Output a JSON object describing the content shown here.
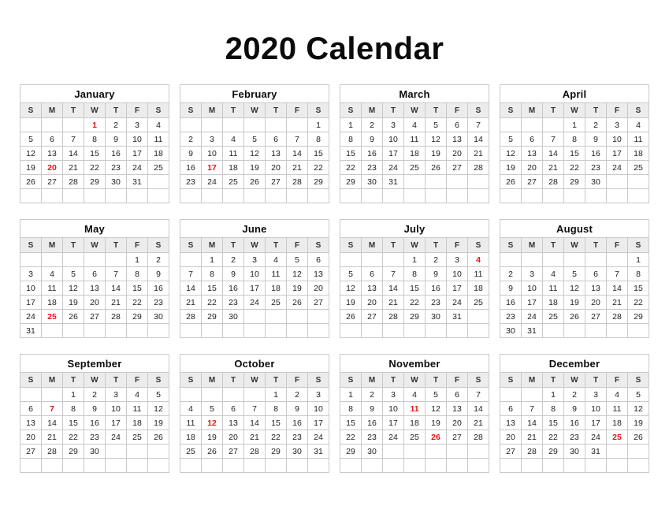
{
  "page": {
    "title": "2020 Calendar",
    "year": "2020",
    "background_color": "#ffffff",
    "title_color": "#0b0b0b",
    "holiday_color": "#ee1111",
    "grid_line_color": "#c9c9c9",
    "weekday_header_background": "#ececec",
    "weekday_header_color": "#333333",
    "day_text_color": "#222222"
  },
  "weekday_labels": [
    "S",
    "M",
    "T",
    "W",
    "T",
    "F",
    "S"
  ],
  "months": [
    {
      "name": "January",
      "weeks": [
        [
          "",
          "",
          "",
          "1",
          "2",
          "3",
          "4"
        ],
        [
          "5",
          "6",
          "7",
          "8",
          "9",
          "10",
          "11"
        ],
        [
          "12",
          "13",
          "14",
          "15",
          "16",
          "17",
          "18"
        ],
        [
          "19",
          "20",
          "21",
          "22",
          "23",
          "24",
          "25"
        ],
        [
          "26",
          "27",
          "28",
          "29",
          "30",
          "31",
          ""
        ],
        [
          "",
          "",
          "",
          "",
          "",
          "",
          ""
        ]
      ],
      "holidays": [
        "1",
        "20"
      ]
    },
    {
      "name": "February",
      "weeks": [
        [
          "",
          "",
          "",
          "",
          "",
          "",
          "1"
        ],
        [
          "2",
          "3",
          "4",
          "5",
          "6",
          "7",
          "8"
        ],
        [
          "9",
          "10",
          "11",
          "12",
          "13",
          "14",
          "15"
        ],
        [
          "16",
          "17",
          "18",
          "19",
          "20",
          "21",
          "22"
        ],
        [
          "23",
          "24",
          "25",
          "26",
          "27",
          "28",
          "29"
        ],
        [
          "",
          "",
          "",
          "",
          "",
          "",
          ""
        ]
      ],
      "holidays": [
        "17"
      ]
    },
    {
      "name": "March",
      "weeks": [
        [
          "1",
          "2",
          "3",
          "4",
          "5",
          "6",
          "7"
        ],
        [
          "8",
          "9",
          "10",
          "11",
          "12",
          "13",
          "14"
        ],
        [
          "15",
          "16",
          "17",
          "18",
          "19",
          "20",
          "21"
        ],
        [
          "22",
          "23",
          "24",
          "25",
          "26",
          "27",
          "28"
        ],
        [
          "29",
          "30",
          "31",
          "",
          "",
          "",
          ""
        ],
        [
          "",
          "",
          "",
          "",
          "",
          "",
          ""
        ]
      ],
      "holidays": []
    },
    {
      "name": "April",
      "weeks": [
        [
          "",
          "",
          "",
          "1",
          "2",
          "3",
          "4"
        ],
        [
          "5",
          "6",
          "7",
          "8",
          "9",
          "10",
          "11"
        ],
        [
          "12",
          "13",
          "14",
          "15",
          "16",
          "17",
          "18"
        ],
        [
          "19",
          "20",
          "21",
          "22",
          "23",
          "24",
          "25"
        ],
        [
          "26",
          "27",
          "28",
          "29",
          "30",
          "",
          ""
        ],
        [
          "",
          "",
          "",
          "",
          "",
          "",
          ""
        ]
      ],
      "holidays": []
    },
    {
      "name": "May",
      "weeks": [
        [
          "",
          "",
          "",
          "",
          "",
          "1",
          "2"
        ],
        [
          "3",
          "4",
          "5",
          "6",
          "7",
          "8",
          "9"
        ],
        [
          "10",
          "11",
          "12",
          "13",
          "14",
          "15",
          "16"
        ],
        [
          "17",
          "18",
          "19",
          "20",
          "21",
          "22",
          "23"
        ],
        [
          "24",
          "25",
          "26",
          "27",
          "28",
          "29",
          "30"
        ],
        [
          "31",
          "",
          "",
          "",
          "",
          "",
          ""
        ]
      ],
      "holidays": [
        "25"
      ]
    },
    {
      "name": "June",
      "weeks": [
        [
          "",
          "1",
          "2",
          "3",
          "4",
          "5",
          "6"
        ],
        [
          "7",
          "8",
          "9",
          "10",
          "11",
          "12",
          "13"
        ],
        [
          "14",
          "15",
          "16",
          "17",
          "18",
          "19",
          "20"
        ],
        [
          "21",
          "22",
          "23",
          "24",
          "25",
          "26",
          "27"
        ],
        [
          "28",
          "29",
          "30",
          "",
          "",
          "",
          ""
        ],
        [
          "",
          "",
          "",
          "",
          "",
          "",
          ""
        ]
      ],
      "holidays": []
    },
    {
      "name": "July",
      "weeks": [
        [
          "",
          "",
          "",
          "1",
          "2",
          "3",
          "4"
        ],
        [
          "5",
          "6",
          "7",
          "8",
          "9",
          "10",
          "11"
        ],
        [
          "12",
          "13",
          "14",
          "15",
          "16",
          "17",
          "18"
        ],
        [
          "19",
          "20",
          "21",
          "22",
          "23",
          "24",
          "25"
        ],
        [
          "26",
          "27",
          "28",
          "29",
          "30",
          "31",
          ""
        ],
        [
          "",
          "",
          "",
          "",
          "",
          "",
          ""
        ]
      ],
      "holidays": [
        "4"
      ]
    },
    {
      "name": "August",
      "weeks": [
        [
          "",
          "",
          "",
          "",
          "",
          "",
          "1"
        ],
        [
          "2",
          "3",
          "4",
          "5",
          "6",
          "7",
          "8"
        ],
        [
          "9",
          "10",
          "11",
          "12",
          "13",
          "14",
          "15"
        ],
        [
          "16",
          "17",
          "18",
          "19",
          "20",
          "21",
          "22"
        ],
        [
          "23",
          "24",
          "25",
          "26",
          "27",
          "28",
          "29"
        ],
        [
          "30",
          "31",
          "",
          "",
          "",
          "",
          ""
        ]
      ],
      "holidays": []
    },
    {
      "name": "September",
      "weeks": [
        [
          "",
          "",
          "1",
          "2",
          "3",
          "4",
          "5"
        ],
        [
          "6",
          "7",
          "8",
          "9",
          "10",
          "11",
          "12"
        ],
        [
          "13",
          "14",
          "15",
          "16",
          "17",
          "18",
          "19"
        ],
        [
          "20",
          "21",
          "22",
          "23",
          "24",
          "25",
          "26"
        ],
        [
          "27",
          "28",
          "29",
          "30",
          "",
          "",
          ""
        ],
        [
          "",
          "",
          "",
          "",
          "",
          "",
          ""
        ]
      ],
      "holidays": [
        "7"
      ]
    },
    {
      "name": "October",
      "weeks": [
        [
          "",
          "",
          "",
          "",
          "1",
          "2",
          "3"
        ],
        [
          "4",
          "5",
          "6",
          "7",
          "8",
          "9",
          "10"
        ],
        [
          "11",
          "12",
          "13",
          "14",
          "15",
          "16",
          "17"
        ],
        [
          "18",
          "19",
          "20",
          "21",
          "22",
          "23",
          "24"
        ],
        [
          "25",
          "26",
          "27",
          "28",
          "29",
          "30",
          "31"
        ],
        [
          "",
          "",
          "",
          "",
          "",
          "",
          ""
        ]
      ],
      "holidays": [
        "12"
      ]
    },
    {
      "name": "November",
      "weeks": [
        [
          "1",
          "2",
          "3",
          "4",
          "5",
          "6",
          "7"
        ],
        [
          "8",
          "9",
          "10",
          "11",
          "12",
          "13",
          "14"
        ],
        [
          "15",
          "16",
          "17",
          "18",
          "19",
          "20",
          "21"
        ],
        [
          "22",
          "23",
          "24",
          "25",
          "26",
          "27",
          "28"
        ],
        [
          "29",
          "30",
          "",
          "",
          "",
          "",
          ""
        ],
        [
          "",
          "",
          "",
          "",
          "",
          "",
          ""
        ]
      ],
      "holidays": [
        "11",
        "26"
      ]
    },
    {
      "name": "December",
      "weeks": [
        [
          "",
          "",
          "1",
          "2",
          "3",
          "4",
          "5"
        ],
        [
          "6",
          "7",
          "8",
          "9",
          "10",
          "11",
          "12"
        ],
        [
          "13",
          "14",
          "15",
          "16",
          "17",
          "18",
          "19"
        ],
        [
          "20",
          "21",
          "22",
          "23",
          "24",
          "25",
          "26"
        ],
        [
          "27",
          "28",
          "29",
          "30",
          "31",
          "",
          ""
        ],
        [
          "",
          "",
          "",
          "",
          "",
          "",
          ""
        ]
      ],
      "holidays": [
        "25"
      ]
    }
  ]
}
